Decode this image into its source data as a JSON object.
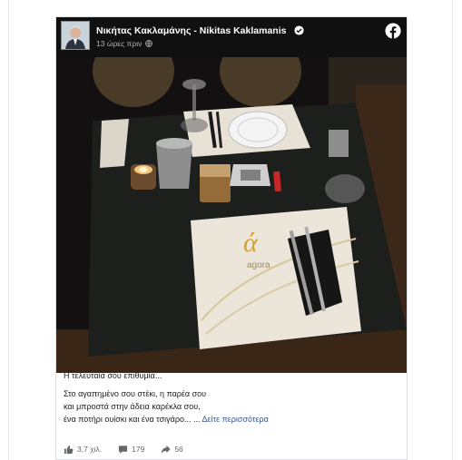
{
  "post": {
    "author": "Νικήτας Κακλαμάνης - Nikitas Kaklamanis",
    "time": "13 ώρες πριν",
    "text_lead": "Η τελευταία σου επιθυμία...",
    "text_line1": "Στο αγαπημένο σου στέκι, η παρέα σου",
    "text_line2": "και μπροστά στην άδεια καρέκλα σου,",
    "text_line3": "ένα ποτήρι ουίσκι και ένα τσιγάρο... ...",
    "see_more": "Δείτε περισσότερα"
  },
  "photo": {
    "placemat_brand_letter": "ά",
    "placemat_brand": "agora"
  },
  "stats": {
    "likes": "3,7 χιλ.",
    "comments": "179",
    "shares": "56"
  },
  "colors": {
    "header_bg": "#101010",
    "link": "#385898",
    "text": "#1c1e21",
    "muted": "#65676b"
  },
  "icons": [
    "verified-icon",
    "globe-icon",
    "facebook-icon",
    "like-icon",
    "comment-icon",
    "share-icon"
  ]
}
